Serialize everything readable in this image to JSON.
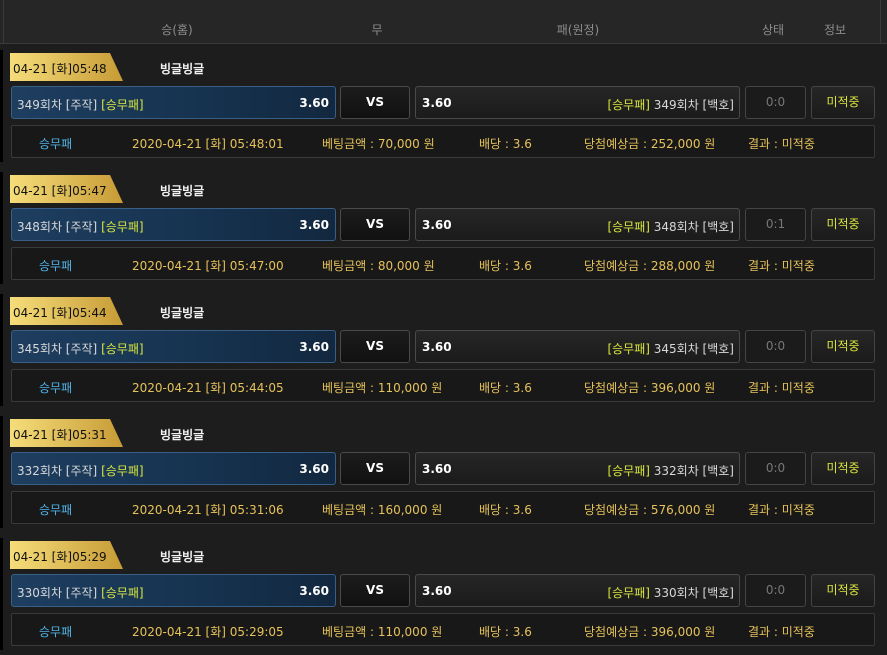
{
  "header": {
    "columns": [
      "승(홈)",
      "무",
      "패(원정)",
      "상태",
      "정보"
    ]
  },
  "colors": {
    "accent_gold": "#d9e63c",
    "detail_text": "#e6c25a",
    "kind_text": "#4fb3e8",
    "home_bg": "#1e3e60"
  },
  "bets": [
    {
      "time": "04-21 [화]05:48",
      "league": "빙글빙글",
      "home_name": "349회차 [주작]",
      "home_tag": "[승무패]",
      "home_odds": "3.60",
      "vs": "VS",
      "away_odds": "3.60",
      "away_tag": "[승무패]",
      "away_name": "349회차 [백호]",
      "score": "0:0",
      "status": "미적중",
      "detail": {
        "kind": "승무패",
        "datetime": "2020-04-21 [화] 05:48:01",
        "bet_amount": "베팅금액 : 70,000 원",
        "rate": "배당 : 3.6",
        "expected": "당첨예상금 : 252,000 원",
        "result": "결과 : 미적중"
      }
    },
    {
      "time": "04-21 [화]05:47",
      "league": "빙글빙글",
      "home_name": "348회차 [주작]",
      "home_tag": "[승무패]",
      "home_odds": "3.60",
      "vs": "VS",
      "away_odds": "3.60",
      "away_tag": "[승무패]",
      "away_name": "348회차 [백호]",
      "score": "0:1",
      "status": "미적중",
      "detail": {
        "kind": "승무패",
        "datetime": "2020-04-21 [화] 05:47:00",
        "bet_amount": "베팅금액 : 80,000 원",
        "rate": "배당 : 3.6",
        "expected": "당첨예상금 : 288,000 원",
        "result": "결과 : 미적중"
      }
    },
    {
      "time": "04-21 [화]05:44",
      "league": "빙글빙글",
      "home_name": "345회차 [주작]",
      "home_tag": "[승무패]",
      "home_odds": "3.60",
      "vs": "VS",
      "away_odds": "3.60",
      "away_tag": "[승무패]",
      "away_name": "345회차 [백호]",
      "score": "0:0",
      "status": "미적중",
      "detail": {
        "kind": "승무패",
        "datetime": "2020-04-21 [화] 05:44:05",
        "bet_amount": "베팅금액 : 110,000 원",
        "rate": "배당 : 3.6",
        "expected": "당첨예상금 : 396,000 원",
        "result": "결과 : 미적중"
      }
    },
    {
      "time": "04-21 [화]05:31",
      "league": "빙글빙글",
      "home_name": "332회차 [주작]",
      "home_tag": "[승무패]",
      "home_odds": "3.60",
      "vs": "VS",
      "away_odds": "3.60",
      "away_tag": "[승무패]",
      "away_name": "332회차 [백호]",
      "score": "0:0",
      "status": "미적중",
      "detail": {
        "kind": "승무패",
        "datetime": "2020-04-21 [화] 05:31:06",
        "bet_amount": "베팅금액 : 160,000 원",
        "rate": "배당 : 3.6",
        "expected": "당첨예상금 : 576,000 원",
        "result": "결과 : 미적중"
      }
    },
    {
      "time": "04-21 [화]05:29",
      "league": "빙글빙글",
      "home_name": "330회차 [주작]",
      "home_tag": "[승무패]",
      "home_odds": "3.60",
      "vs": "VS",
      "away_odds": "3.60",
      "away_tag": "[승무패]",
      "away_name": "330회차 [백호]",
      "score": "0:0",
      "status": "미적중",
      "detail": {
        "kind": "승무패",
        "datetime": "2020-04-21 [화] 05:29:05",
        "bet_amount": "베팅금액 : 110,000 원",
        "rate": "배당 : 3.6",
        "expected": "당첨예상금 : 396,000 원",
        "result": "결과 : 미적중"
      }
    }
  ]
}
